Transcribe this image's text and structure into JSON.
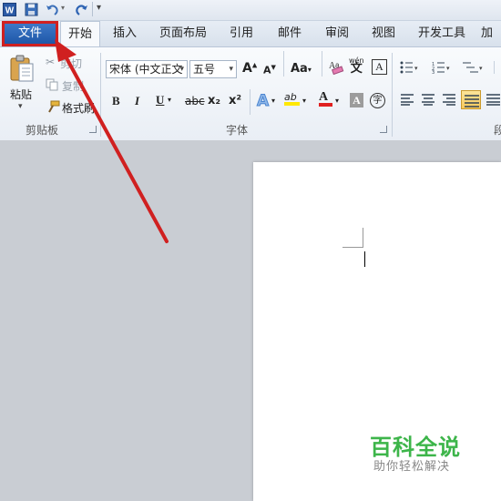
{
  "quick_access": {
    "icons": [
      "word-logo-icon",
      "save-icon",
      "undo-icon",
      "redo-icon",
      "customize-qat-icon"
    ]
  },
  "tabs": [
    "文件",
    "开始",
    "插入",
    "页面布局",
    "引用",
    "邮件",
    "审阅",
    "视图",
    "开发工具",
    "加"
  ],
  "clipboard": {
    "paste_label": "粘贴",
    "cut_label": "剪切",
    "copy_label": "复制",
    "format_painter_label": "格式刷",
    "group_label": "剪贴板"
  },
  "font": {
    "font_name": "宋体 (中文正文",
    "font_size": "五号",
    "grow_label": "A",
    "shrink_label": "A",
    "case_label": "Aa",
    "bold": "B",
    "italic": "I",
    "underline": "U",
    "strike": "abc",
    "subscript": "x₂",
    "superscript": "x²",
    "text_effect": "A",
    "highlight": "ab",
    "font_color": "A",
    "char_shading": "A",
    "enclose": "字",
    "wen_label": "wén",
    "wen_char": "文",
    "char_border": "A",
    "group_label": "字体"
  },
  "paragraph": {
    "group_label": "段"
  },
  "watermark": {
    "title": "百科全说",
    "subtitle": "助你轻松解决"
  },
  "colors": {
    "file_tab": "#2a62b3",
    "highlight": "#d02020",
    "watermark": "#3db54a"
  }
}
